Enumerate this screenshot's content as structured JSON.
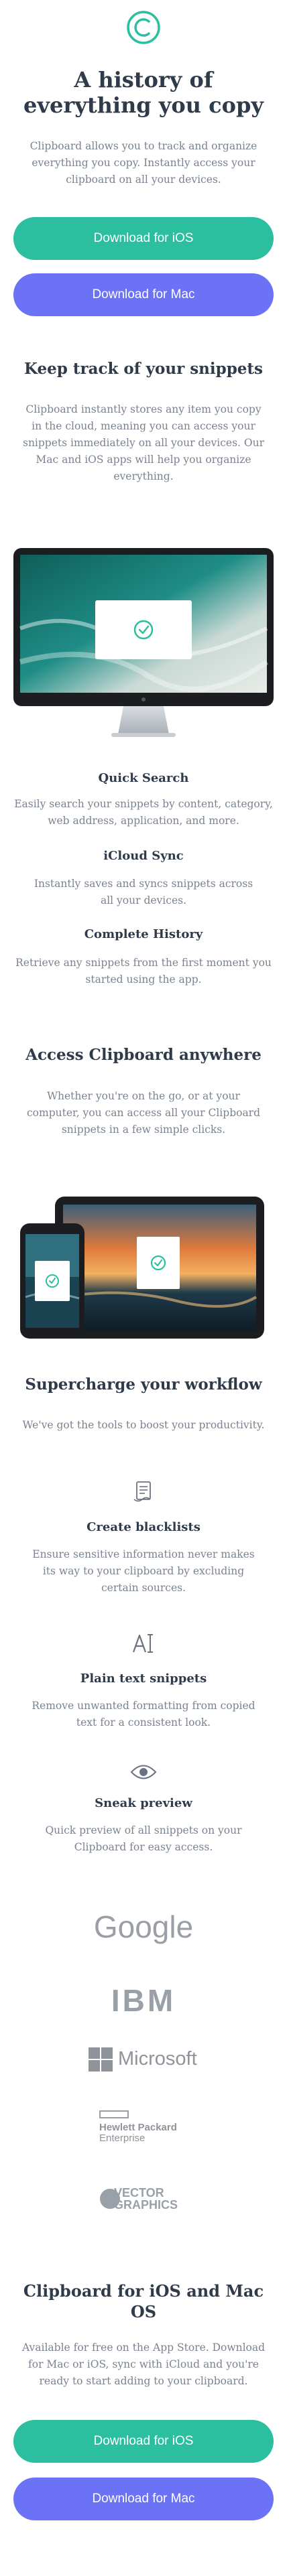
{
  "hero": {
    "title": "A history of everything you copy",
    "subtitle": "Clipboard allows you to track and organize everything you copy. Instantly access your clipboard on all your devices.",
    "ios_button": "Download for iOS",
    "mac_button": "Download for Mac"
  },
  "snippets": {
    "title": "Keep track of your snippets",
    "text": "Clipboard instantly stores any item you copy in the cloud, meaning you can access your snippets immediately on all your devices. Our Mac and iOS apps will help you organize everything."
  },
  "features": [
    {
      "title": "Quick Search",
      "text": "Easily search your snippets by content, category, web address, application, and more."
    },
    {
      "title": "iCloud Sync",
      "text": "Instantly saves and syncs snippets across all your devices."
    },
    {
      "title": "Complete History",
      "text": "Retrieve any snippets from the first moment you started using the app."
    }
  ],
  "access": {
    "title": "Access Clipboard anywhere",
    "text": "Whether you're on the go, or at your computer, you can access all your Clipboard snippets in a few simple clicks."
  },
  "workflow": {
    "title": "Supercharge your workflow",
    "text": "We've got the tools to boost your productivity.",
    "items": [
      {
        "icon": "blacklist-icon",
        "title": "Create blacklists",
        "text": "Ensure sensitive information never makes its way to your clipboard by excluding certain sources."
      },
      {
        "icon": "text-icon",
        "title": "Plain text snippets",
        "text": "Remove unwanted formatting from copied text for a consistent look."
      },
      {
        "icon": "eye-icon",
        "title": "Sneak preview",
        "text": "Quick preview of all snippets on your Clipboard for easy access."
      }
    ]
  },
  "brands": {
    "google": "Google",
    "ibm": "IBM",
    "microsoft": "Microsoft",
    "hp_line1": "Hewlett Packard",
    "hp_line2": "Enterprise",
    "vector_line1": "VECTOR",
    "vector_line2": "GRAPHICS"
  },
  "cta": {
    "title": "Clipboard for iOS and Mac OS",
    "text": "Available for free on the App Store. Download for Mac or iOS, sync with iCloud and you're ready to start adding to your clipboard.",
    "ios_button": "Download for iOS",
    "mac_button": "Download for Mac"
  },
  "colors": {
    "accent_teal": "#2bbf9f",
    "accent_blue": "#6b72f5",
    "heading": "#2f3a4a",
    "body_text": "#7a8391"
  }
}
